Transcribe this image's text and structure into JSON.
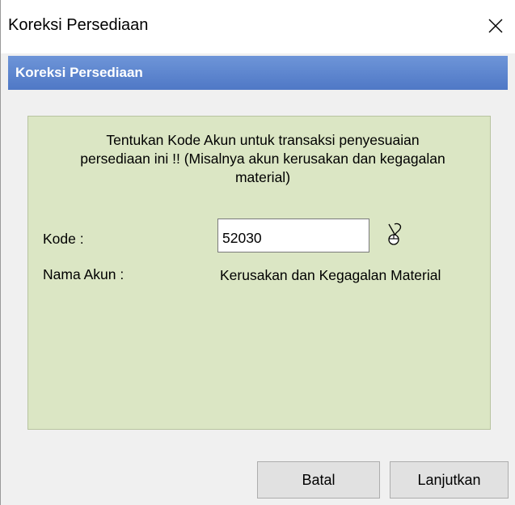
{
  "window": {
    "title": "Koreksi Persediaan",
    "close_icon": "close-icon"
  },
  "header": {
    "title": "Koreksi Persediaan"
  },
  "form": {
    "instruction": "Tentukan Kode Akun untuk transaksi penyesuaian persediaan ini !! (Misalnya akun kerusakan dan kegagalan material)",
    "kode_label": "Kode :",
    "kode_value": "52030",
    "lookup_icon": "mouse-pointer-lookup-icon",
    "nama_label": "Nama Akun :",
    "nama_value": "Kerusakan dan Kegagalan Material"
  },
  "buttons": {
    "cancel_label": "Batal",
    "continue_label": "Lanjutkan"
  },
  "colors": {
    "header_band": "#5a83cf",
    "panel_bg": "#dbe6c4",
    "window_bg": "#f0f0f0"
  }
}
